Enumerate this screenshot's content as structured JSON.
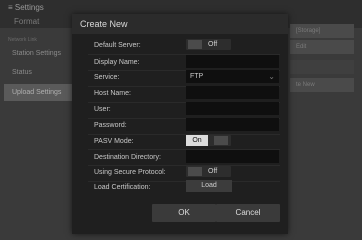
{
  "background": {
    "title": "≡ Settings",
    "format": "Format",
    "section": "Network Link",
    "nav": [
      "Station Settings",
      "Status",
      "Upload Settings"
    ],
    "right": [
      "[Storage]",
      "Edit",
      "",
      "te New"
    ]
  },
  "dialog": {
    "title": "Create New",
    "default_server": {
      "label": "Default Server:",
      "value": "Off"
    },
    "display_name": {
      "label": "Display Name:",
      "value": ""
    },
    "service": {
      "label": "Service:",
      "value": "FTP"
    },
    "host_name": {
      "label": "Host Name:",
      "value": ""
    },
    "user": {
      "label": "User:",
      "value": ""
    },
    "password": {
      "label": "Password:",
      "value": ""
    },
    "pasv_mode": {
      "label": "PASV Mode:",
      "value": "On"
    },
    "destination": {
      "label": "Destination Directory:",
      "value": ""
    },
    "secure": {
      "label": "Using Secure Protocol:",
      "value": "Off"
    },
    "load_cert": {
      "label": "Load Certification:",
      "button": "Load"
    },
    "ok": "OK",
    "cancel": "Cancel"
  }
}
